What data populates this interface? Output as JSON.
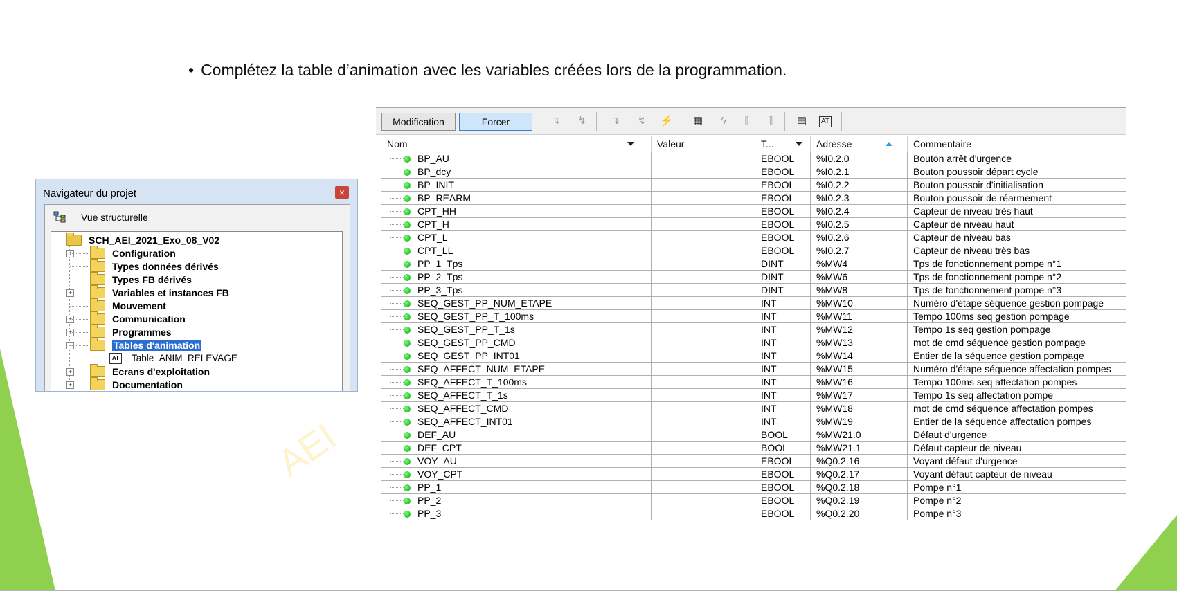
{
  "slide": {
    "bullet": "Complétez la table d’animation avec les variables créées lors de la programmation.",
    "watermark": "AEI"
  },
  "navigator": {
    "title": "Navigateur du projet",
    "view_label": "Vue structurelle",
    "root": "SCH_AEI_2021_Exo_08_V02",
    "items": [
      {
        "label": "Configuration",
        "expandable": true
      },
      {
        "label": "Types données dérivés",
        "expandable": false
      },
      {
        "label": "Types FB dérivés",
        "expandable": false
      },
      {
        "label": "Variables et instances FB",
        "expandable": true
      },
      {
        "label": "Mouvement",
        "expandable": false
      },
      {
        "label": "Communication",
        "expandable": true
      },
      {
        "label": "Programmes",
        "expandable": true
      },
      {
        "label": "Tables d'animation",
        "expandable": true,
        "selected": true
      },
      {
        "label": "Ecrans d'exploitation",
        "expandable": true
      },
      {
        "label": "Documentation",
        "expandable": true
      }
    ],
    "child": "Table_ANIM_RELEVAGE"
  },
  "toolbar": {
    "modification": "Modification",
    "forcer": "Forcer"
  },
  "table": {
    "headers": [
      "Nom",
      "Valeur",
      "T...",
      "Adresse",
      "Commentaire"
    ],
    "rows": [
      [
        "BP_AU",
        "",
        "EBOOL",
        "%I0.2.0",
        "Bouton arrêt d'urgence"
      ],
      [
        "BP_dcy",
        "",
        "EBOOL",
        "%I0.2.1",
        "Bouton poussoir départ cycle"
      ],
      [
        "BP_INIT",
        "",
        "EBOOL",
        "%I0.2.2",
        "Bouton poussoir d'initialisation"
      ],
      [
        "BP_REARM",
        "",
        "EBOOL",
        "%I0.2.3",
        "Bouton poussoir de réarmement"
      ],
      [
        "CPT_HH",
        "",
        "EBOOL",
        "%I0.2.4",
        "Capteur de niveau très haut"
      ],
      [
        "CPT_H",
        "",
        "EBOOL",
        "%I0.2.5",
        "Capteur de niveau haut"
      ],
      [
        "CPT_L",
        "",
        "EBOOL",
        "%I0.2.6",
        "Capteur de niveau bas"
      ],
      [
        "CPT_LL",
        "",
        "EBOOL",
        "%I0.2.7",
        "Capteur de niveau très bas"
      ],
      [
        "PP_1_Tps",
        "",
        "DINT",
        "%MW4",
        "Tps de fonctionnement pompe n°1"
      ],
      [
        "PP_2_Tps",
        "",
        "DINT",
        "%MW6",
        "Tps de fonctionnement pompe n°2"
      ],
      [
        "PP_3_Tps",
        "",
        "DINT",
        "%MW8",
        "Tps de fonctionnement pompe n°3"
      ],
      [
        "SEQ_GEST_PP_NUM_ETAPE",
        "",
        "INT",
        "%MW10",
        "Numéro d'étape séquence gestion pompage"
      ],
      [
        "SEQ_GEST_PP_T_100ms",
        "",
        "INT",
        "%MW11",
        "Tempo 100ms seq gestion pompage"
      ],
      [
        "SEQ_GEST_PP_T_1s",
        "",
        "INT",
        "%MW12",
        "Tempo 1s seq gestion pompage"
      ],
      [
        "SEQ_GEST_PP_CMD",
        "",
        "INT",
        "%MW13",
        "mot de cmd séquence gestion pompage"
      ],
      [
        "SEQ_GEST_PP_INT01",
        "",
        "INT",
        "%MW14",
        "Entier de la séquence gestion pompage"
      ],
      [
        "SEQ_AFFECT_NUM_ETAPE",
        "",
        "INT",
        "%MW15",
        "Numéro d'étape séquence affectation pompes"
      ],
      [
        "SEQ_AFFECT_T_100ms",
        "",
        "INT",
        "%MW16",
        "Tempo 100ms seq affectation pompes"
      ],
      [
        "SEQ_AFFECT_T_1s",
        "",
        "INT",
        "%MW17",
        "Tempo 1s seq affectation pompe"
      ],
      [
        "SEQ_AFFECT_CMD",
        "",
        "INT",
        "%MW18",
        "mot de cmd séquence affectation pompes"
      ],
      [
        "SEQ_AFFECT_INT01",
        "",
        "INT",
        "%MW19",
        "Entier de la séquence affectation pompes"
      ],
      [
        "DEF_AU",
        "",
        "BOOL",
        "%MW21.0",
        "Défaut d'urgence"
      ],
      [
        "DEF_CPT",
        "",
        "BOOL",
        "%MW21.1",
        "Défaut capteur de niveau"
      ],
      [
        "VOY_AU",
        "",
        "EBOOL",
        "%Q0.2.16",
        "Voyant défaut d'urgence"
      ],
      [
        "VOY_CPT",
        "",
        "EBOOL",
        "%Q0.2.17",
        "Voyant défaut capteur de niveau"
      ],
      [
        "PP_1",
        "",
        "EBOOL",
        "%Q0.2.18",
        "Pompe n°1"
      ],
      [
        "PP_2",
        "",
        "EBOOL",
        "%Q0.2.19",
        "Pompe n°2"
      ],
      [
        "PP_3",
        "",
        "EBOOL",
        "%Q0.2.20",
        "Pompe n°3"
      ]
    ]
  },
  "colors": {
    "accent_green": "#8fd14f",
    "selection_blue": "#2a6fd0",
    "status_green": "#0aa30a"
  }
}
